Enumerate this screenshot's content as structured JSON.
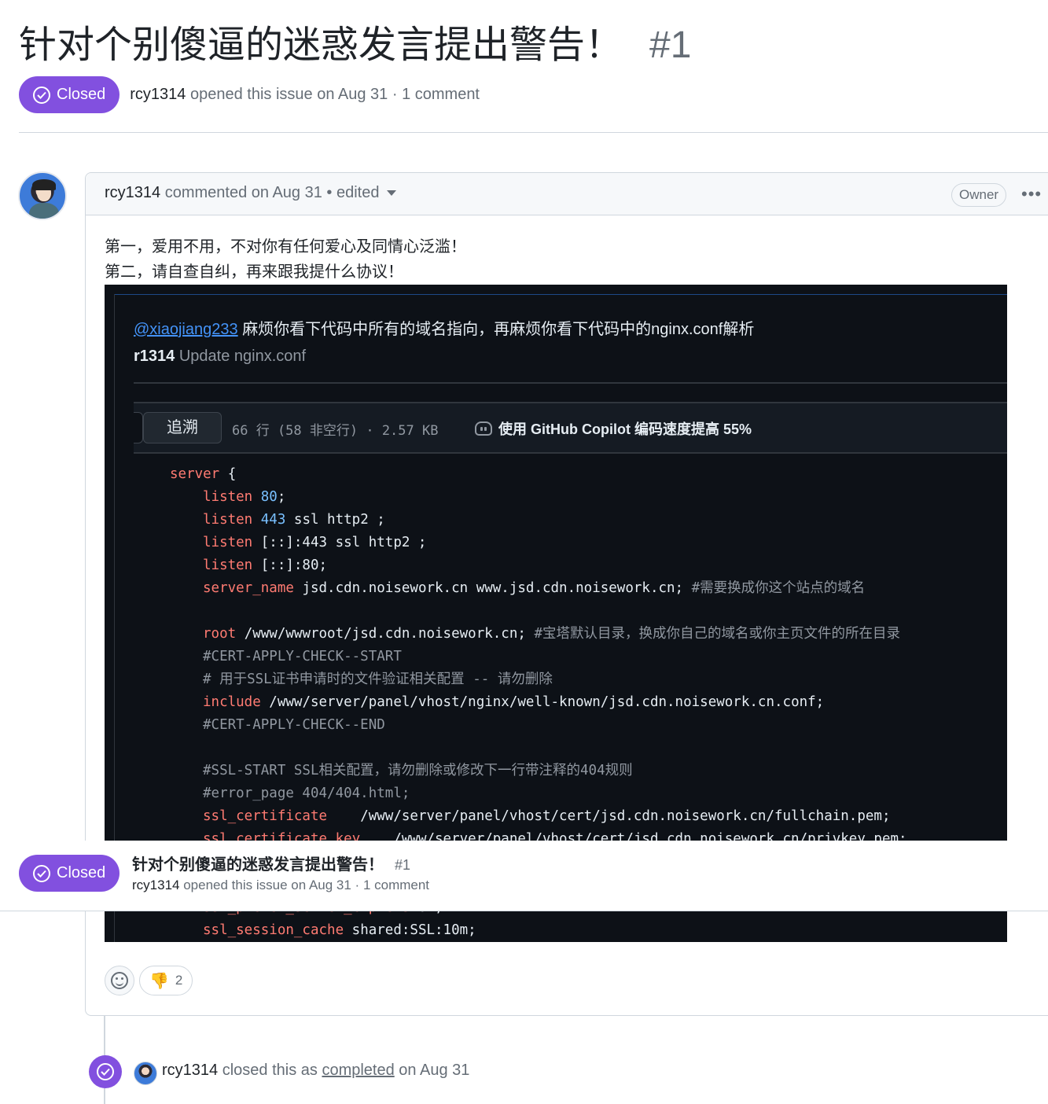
{
  "issue": {
    "title": "针对个别傻逼的迷惑发言提出警告！",
    "number": "#1",
    "state": "Closed",
    "author": "rcy1314",
    "meta": "opened this issue on Aug 31 · 1 comment"
  },
  "comment": {
    "author": "rcy1314",
    "header_text": "commented on Aug 31 • edited",
    "role_badge": "Owner",
    "body_lines": [
      "第一，爱用不用，不对你有任何爱心及同情心泛滥！",
      "第二，请自查自纠，再来跟我提什么协议！"
    ],
    "screenshot": {
      "mention": "@xiaojiang233",
      "mention_text": "麻烦你看下代码中所有的域名指向，再麻烦你看下代码中的nginx.conf解析",
      "commit_author": "r1314",
      "commit_msg": "Update nginx.conf",
      "blame_label": "追溯",
      "file_info": "66 行 (58 非空行) · 2.57 KB",
      "copilot_text": "使用 GitHub Copilot 编码速度提高 55%"
    }
  },
  "reactions": {
    "thumbs_down_count": "2"
  },
  "sticky": {
    "title": "针对个别傻逼的迷惑发言提出警告！",
    "number": "#1",
    "state": "Closed",
    "author": "rcy1314",
    "meta": "opened this issue on Aug 31 · 1 comment"
  },
  "event": {
    "author": "rcy1314",
    "text_before": "closed this as",
    "link": "completed",
    "text_after": "on Aug 31"
  },
  "colors": {
    "closed_purple": "#8250df",
    "code_bg": "#0d1117",
    "keyword": "#ff7b72",
    "number": "#79c0ff"
  }
}
